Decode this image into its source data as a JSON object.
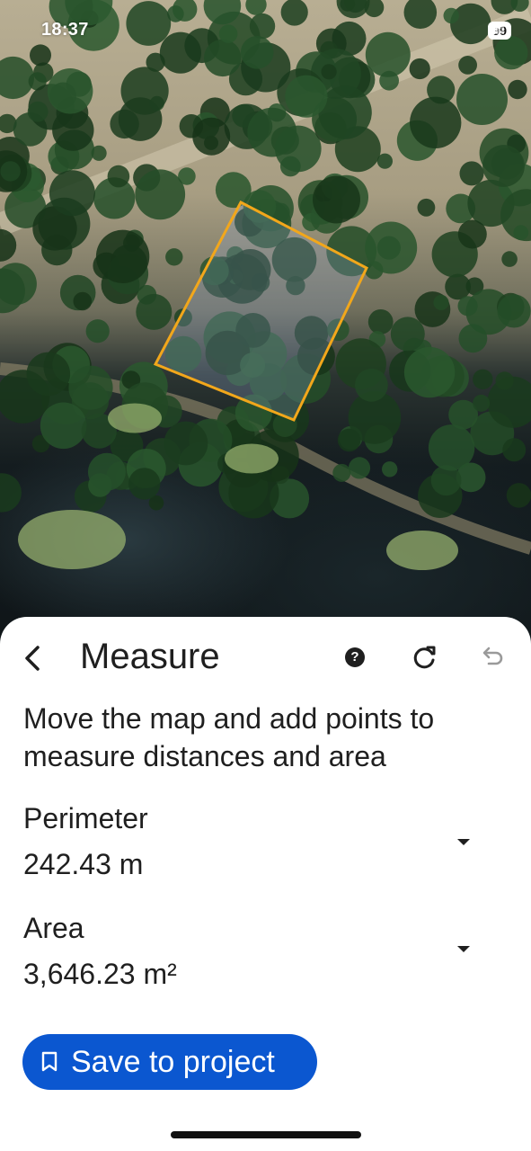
{
  "status_bar": {
    "time": "18:37",
    "battery": "99"
  },
  "colors": {
    "accent": "#0b57d0",
    "polygon": "#f2a71b",
    "text": "#1f1f1f"
  },
  "icons": {
    "back": "chevron-left-icon",
    "help": "help-circle-icon",
    "reset": "refresh-icon",
    "undo": "undo-icon",
    "dropdown": "caret-down-icon",
    "bookmark": "bookmark-icon"
  },
  "header": {
    "title": "Measure",
    "help_glyph": "?"
  },
  "instructions": "Move the map and add points to measure distances and area",
  "perimeter": {
    "label": "Perimeter",
    "value": "242.43 m"
  },
  "area": {
    "label": "Area",
    "value": "3,646.23 m²"
  },
  "save_button": {
    "label": "Save to project"
  }
}
